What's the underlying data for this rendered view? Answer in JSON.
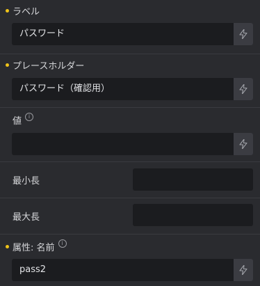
{
  "fields": {
    "label": {
      "title": "ラベル",
      "value": "パスワード"
    },
    "placeholder": {
      "title": "プレースホルダー",
      "value": "パスワード（確認用）"
    },
    "value": {
      "title": "値",
      "value": ""
    },
    "minlength": {
      "title": "最小長",
      "value": ""
    },
    "maxlength": {
      "title": "最大長",
      "value": ""
    },
    "name_attr": {
      "title": "属性: 名前",
      "value": "pass2"
    }
  },
  "icons": {
    "dynamic": "lightning-icon",
    "info": "info-icon",
    "modified": "modified-dot-icon"
  },
  "colors": {
    "background": "#2a2b2f",
    "input": "#1b1c1f",
    "button": "#3b3c42",
    "dot": "#f0c419"
  }
}
